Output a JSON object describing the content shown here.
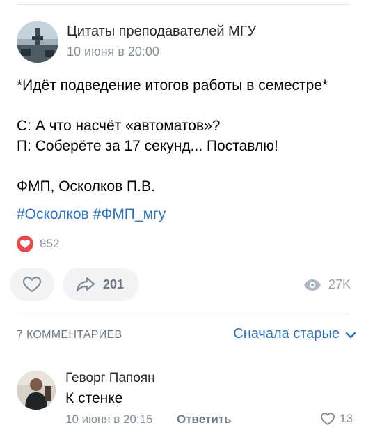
{
  "post": {
    "group_name": "Цитаты преподавателей МГУ",
    "date": "10 июня в 20:00",
    "text_lines": [
      "*Идёт подведение итогов работы в семестре*",
      "",
      "С: А что насчёт «автоматов»?",
      "П: Соберёте за 17 секунд... Поставлю!",
      "",
      "ФМП, Осколков П.В."
    ],
    "hashtags": [
      "#Осколков",
      "#ФМП_мгу"
    ],
    "reactions_count": "852",
    "share_count": "201",
    "views_count": "27K"
  },
  "comments_section": {
    "title": "7 КОММЕНТАРИЕВ",
    "sort_label": "Сначала старые"
  },
  "comment": {
    "author": "Геворг Папоян",
    "text": "К стенке",
    "date": "10 июня в 20:15",
    "reply_label": "Ответить",
    "likes": "13"
  },
  "colors": {
    "accent": "#2a72c0",
    "secondary_text": "#818c99",
    "button_bg": "#f2f3f5",
    "reaction_red": "#e64646"
  },
  "icons": [
    "heart-icon",
    "share-arrow-icon",
    "eye-icon",
    "chevron-down-icon",
    "heart-outline-icon"
  ]
}
